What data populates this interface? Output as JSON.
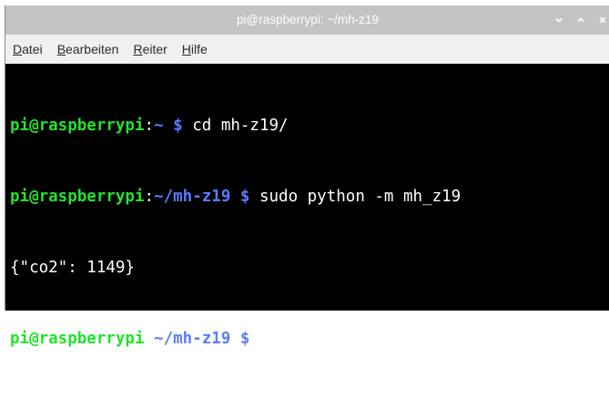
{
  "window": {
    "title": "pi@raspberrypi: ~/mh-z19",
    "controls": {
      "minimize_icon": "chevron-down-icon",
      "maximize_icon": "chevron-up-icon",
      "close_icon": "close-icon"
    }
  },
  "menu": {
    "items": [
      {
        "mnemonic": "D",
        "rest": "atei"
      },
      {
        "mnemonic": "B",
        "rest": "earbeiten"
      },
      {
        "mnemonic": "R",
        "rest": "eiter"
      },
      {
        "mnemonic": "H",
        "rest": "ilfe"
      }
    ]
  },
  "terminal": {
    "lines": [
      {
        "user_host": "pi@raspberrypi",
        "sep": ":",
        "path": "~",
        "prompt": " $ ",
        "command": "cd mh-z19/"
      },
      {
        "user_host": "pi@raspberrypi",
        "sep": ":",
        "path": "~/mh-z19",
        "prompt": " $ ",
        "command": "sudo python -m mh_z19"
      },
      {
        "output": "{\"co2\": 1149}"
      },
      {
        "user_host": "pi@raspberrypi",
        "sep": ":",
        "path": "~/mh-z19",
        "prompt": " $ ",
        "command": ""
      }
    ]
  },
  "colors": {
    "prompt_host": "#22e32a",
    "prompt_path": "#5b7cff",
    "terminal_bg": "#000000",
    "titlebar_bg": "#c4c4c4"
  }
}
